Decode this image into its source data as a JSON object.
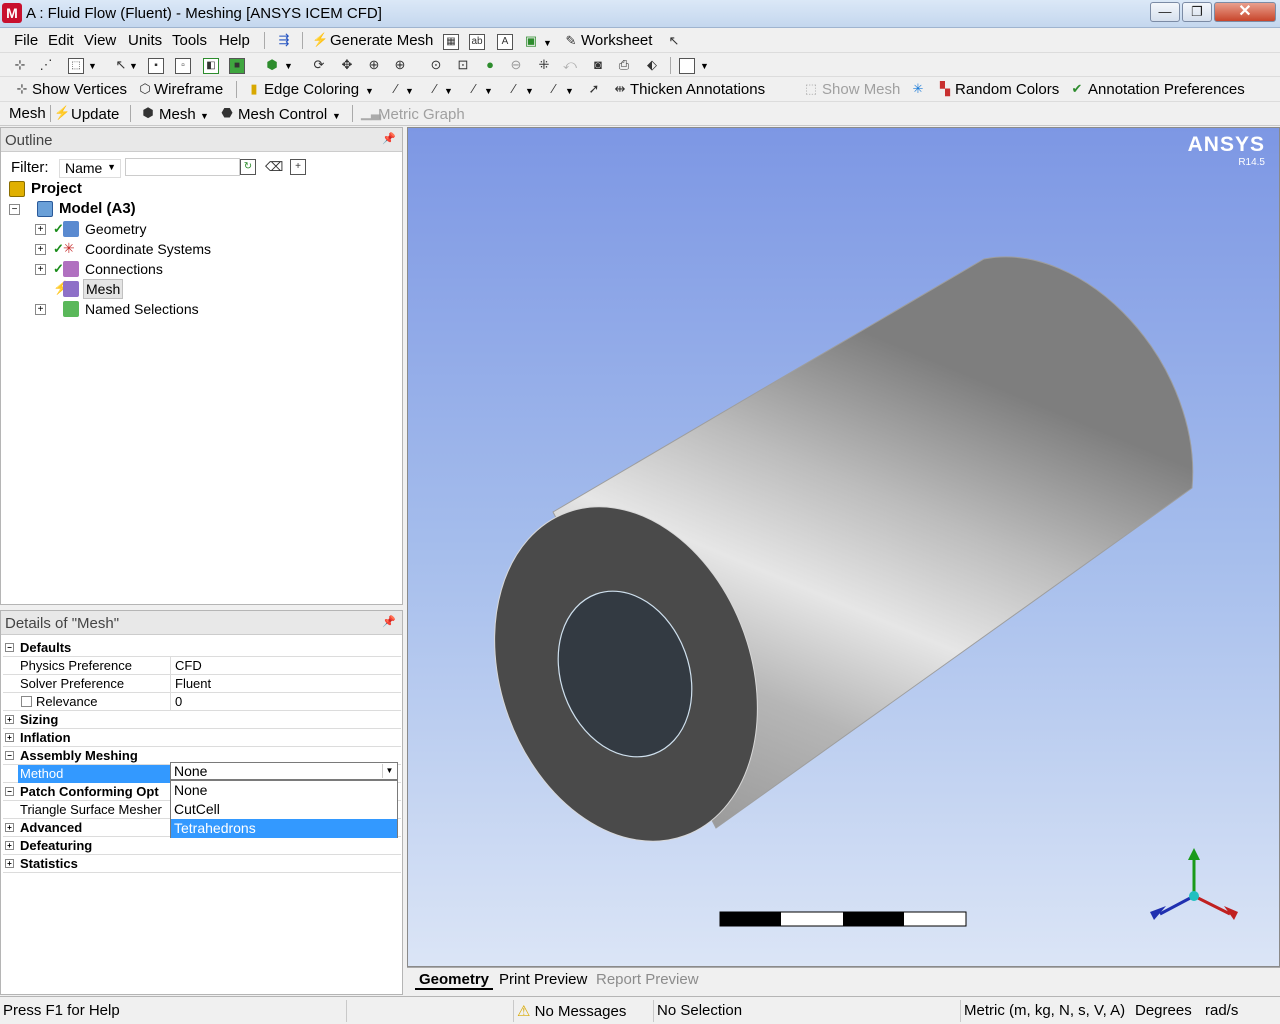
{
  "window": {
    "title": "A : Fluid Flow (Fluent) - Meshing [ANSYS ICEM CFD]",
    "logo_letter": "M",
    "minimize_glyph": "—",
    "maximize_glyph": "❐",
    "close_glyph": "✕"
  },
  "menu": {
    "file": "File",
    "edit": "Edit",
    "view": "View",
    "units": "Units",
    "tools": "Tools",
    "help": "Help",
    "generate_mesh": "Generate Mesh",
    "worksheet": "Worksheet"
  },
  "toolbar3": {
    "show_vertices": "Show Vertices",
    "wireframe": "Wireframe",
    "edge_coloring": "Edge Coloring",
    "thicken_annotations": "Thicken Annotations",
    "show_mesh": "Show Mesh",
    "random_colors": "Random Colors",
    "annotation_preferences": "Annotation Preferences"
  },
  "toolbar4": {
    "mesh_label": "Mesh",
    "update": "Update",
    "mesh_menu": "Mesh",
    "mesh_control": "Mesh Control",
    "metric_graph": "Metric Graph"
  },
  "outline": {
    "title": "Outline",
    "filter_label": "Filter:",
    "filter_value": "Name",
    "tree": {
      "project": "Project",
      "model": "Model (A3)",
      "geometry": "Geometry",
      "coordinate_systems": "Coordinate Systems",
      "connections": "Connections",
      "mesh": "Mesh",
      "named_selections": "Named Selections"
    }
  },
  "details": {
    "title": "Details of \"Mesh\"",
    "groups": {
      "defaults": "Defaults",
      "sizing": "Sizing",
      "inflation": "Inflation",
      "assembly_meshing": "Assembly Meshing",
      "patch_conforming": "Patch Conforming Opt",
      "advanced": "Advanced",
      "defeaturing": "Defeaturing",
      "statistics": "Statistics"
    },
    "rows": {
      "physics_preference": {
        "name": "Physics Preference",
        "value": "CFD"
      },
      "solver_preference": {
        "name": "Solver Preference",
        "value": "Fluent"
      },
      "relevance": {
        "name": "Relevance",
        "value": "0"
      },
      "method": {
        "name": "Method",
        "value": "None"
      },
      "triangle_surface_mesher": {
        "name": "Triangle Surface Mesher"
      }
    },
    "method_options": [
      "None",
      "CutCell",
      "Tetrahedrons"
    ],
    "highlighted_option": "Tetrahedrons"
  },
  "viewport": {
    "brand": "ANSYS",
    "version": "R14.5",
    "colors": {
      "cylinder_body": "#bdbdbd",
      "cylinder_end": "#4a4a4a",
      "inner_bore": "#333a42",
      "bore_edge": "#cfe0ee"
    }
  },
  "tabs": {
    "geometry": "Geometry",
    "print_preview": "Print Preview",
    "report_preview": "Report Preview"
  },
  "status": {
    "help": "Press F1 for Help",
    "messages": "No Messages",
    "selection": "No Selection",
    "units": "Metric (m, kg, N, s, V, A)",
    "angle": "Degrees",
    "angular_velocity": "rad/s"
  },
  "colors": {
    "selection_blue": "#3399ff",
    "titlebar": "#c4d7ee",
    "close_button": "#c8452b"
  }
}
